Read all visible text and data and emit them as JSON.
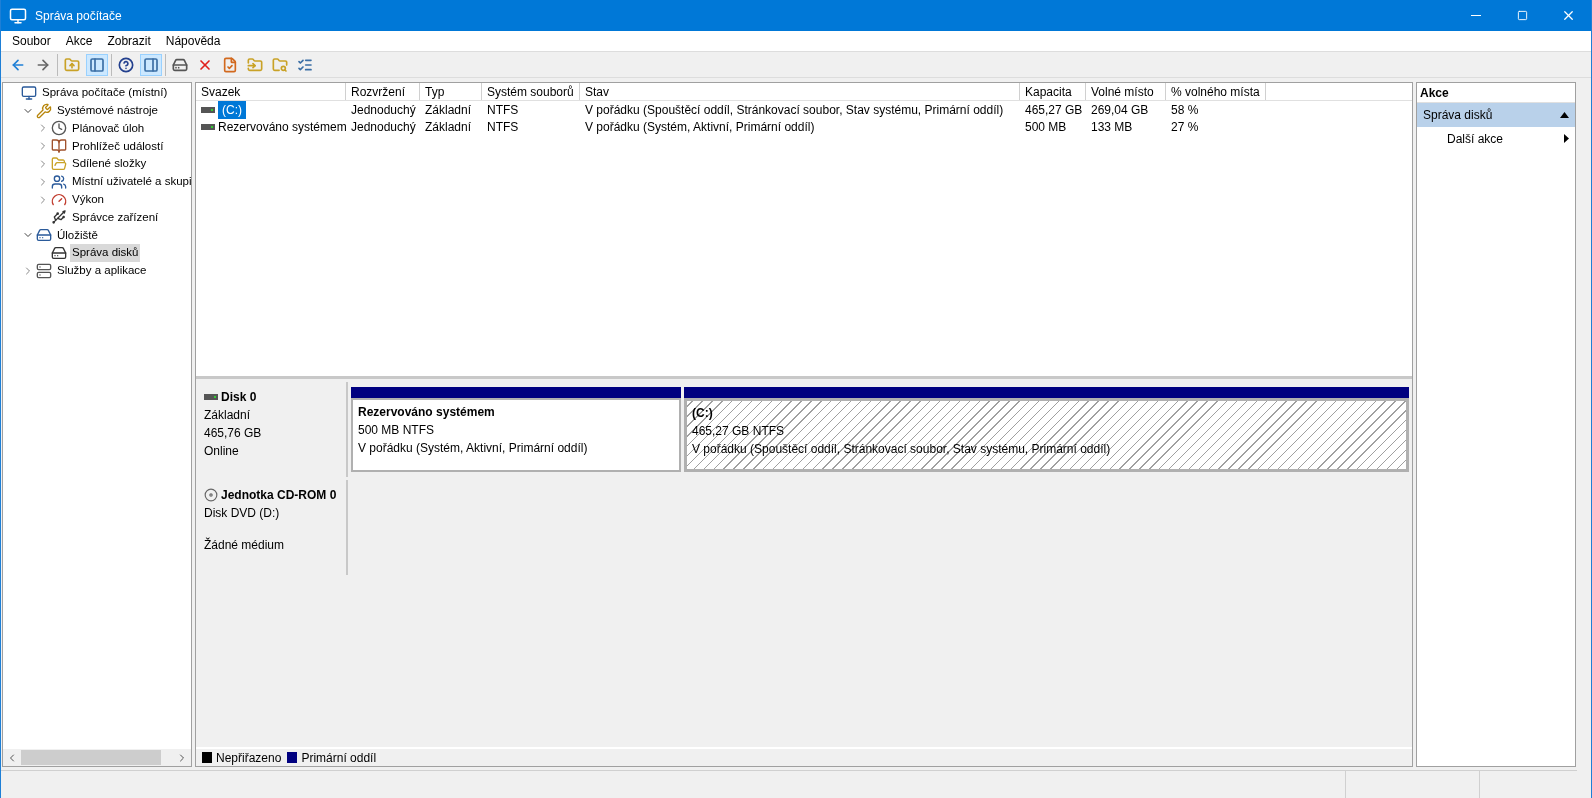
{
  "window": {
    "title": "Správa počítače"
  },
  "menu": [
    {
      "label": "Soubor"
    },
    {
      "label": "Akce"
    },
    {
      "label": "Zobrazit"
    },
    {
      "label": "Nápověda"
    }
  ],
  "toolbar": [
    [
      {
        "kind": "back",
        "pressed": false
      },
      {
        "kind": "forward",
        "pressed": false
      }
    ],
    [
      {
        "kind": "up-folder",
        "pressed": false
      },
      {
        "kind": "tree-pane",
        "pressed": true
      }
    ],
    [
      {
        "kind": "help",
        "pressed": false
      },
      {
        "kind": "action-pane",
        "pressed": true
      }
    ],
    [
      {
        "kind": "drive",
        "pressed": false
      },
      {
        "kind": "delete",
        "pressed": false
      },
      {
        "kind": "properties",
        "pressed": false
      },
      {
        "kind": "folder-up",
        "pressed": false
      },
      {
        "kind": "folder-search",
        "pressed": false
      },
      {
        "kind": "checklist",
        "pressed": false
      }
    ]
  ],
  "tree": {
    "label": "Správa počítače (místní)",
    "kind": "computer",
    "selected": false,
    "children": [
      {
        "label": "Systémové nástroje",
        "kind": "tools",
        "expanded": true,
        "selected": false,
        "children": [
          {
            "label": "Plánovač úloh",
            "kind": "clock",
            "expanded": false,
            "selected": false
          },
          {
            "label": "Prohlížeč událostí",
            "kind": "events",
            "expanded": false,
            "selected": false
          },
          {
            "label": "Sdílené složky",
            "kind": "shared",
            "expanded": false,
            "selected": false
          },
          {
            "label": "Místní uživatelé a skupi",
            "kind": "users",
            "expanded": false,
            "selected": false
          },
          {
            "label": "Výkon",
            "kind": "performance",
            "expanded": false,
            "selected": false
          },
          {
            "label": "Správce zařízení",
            "kind": "devices",
            "selected": false
          }
        ]
      },
      {
        "label": "Úložiště",
        "kind": "storage",
        "expanded": true,
        "selected": false,
        "children": [
          {
            "label": "Správa disků",
            "kind": "disk",
            "selected": true
          }
        ]
      },
      {
        "label": "Služby a aplikace",
        "kind": "services",
        "expanded": false,
        "selected": false
      }
    ]
  },
  "volume_table": {
    "columns": [
      "Svazek",
      "Rozvržení",
      "Typ",
      "Systém souborů",
      "Stav",
      "Kapacita",
      "Volné místo",
      "% volného místa"
    ],
    "rows": [
      {
        "selected": true,
        "cells": [
          "(C:)",
          "Jednoduchý",
          "Základní",
          "NTFS",
          "V pořádku (Spouštěcí oddíl, Stránkovací soubor, Stav systému, Primární oddíl)",
          "465,27 GB",
          "269,04 GB",
          "58 %"
        ]
      },
      {
        "selected": false,
        "cells": [
          "Rezervováno systémem",
          "Jednoduchý",
          "Základní",
          "NTFS",
          "V pořádku (Systém, Aktivní, Primární oddíl)",
          "500 MB",
          "133 MB",
          "27 %"
        ]
      }
    ]
  },
  "disks": [
    {
      "kind": "disk",
      "name": "Disk 0",
      "type": "Základní",
      "size": "465,76 GB",
      "status": "Online",
      "partitions": [
        {
          "name": "Rezervováno systémem",
          "size": "500 MB NTFS",
          "status": "V pořádku (Systém, Aktivní, Primární oddíl)",
          "color": "#000080",
          "selected": false
        },
        {
          "name": "(C:)",
          "size": "465,27 GB NTFS",
          "status": "V pořádku (Spouštěcí oddíl, Stránkovací soubor, Stav systému, Primární oddíl)",
          "color": "#000080",
          "selected": true
        }
      ]
    },
    {
      "kind": "cdrom",
      "name": "Jednotka CD-ROM 0",
      "type": "Disk DVD (D:)",
      "status": "Žádné médium"
    }
  ],
  "legend": [
    {
      "label": "Nepřiřazeno",
      "color": "#000000"
    },
    {
      "label": "Primární oddíl",
      "color": "#000080"
    }
  ],
  "actions": {
    "title": "Akce",
    "sections": [
      {
        "label": "Správa disků",
        "expanded": true,
        "items": [
          {
            "label": "Další akce"
          }
        ]
      }
    ]
  }
}
